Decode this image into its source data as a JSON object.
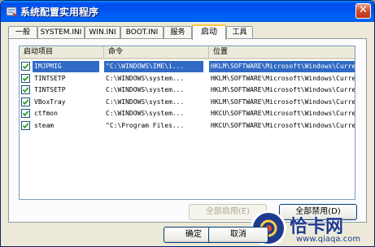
{
  "window": {
    "title": "系统配置实用程序",
    "close_glyph": "✕"
  },
  "tabs": [
    {
      "label": "一般"
    },
    {
      "label": "SYSTEM.INI"
    },
    {
      "label": "WIN.INI"
    },
    {
      "label": "BOOT.INI"
    },
    {
      "label": "服务"
    },
    {
      "label": "启动"
    },
    {
      "label": "工具"
    }
  ],
  "active_tab": "启动",
  "columns": [
    "启动项目",
    "命令",
    "位置"
  ],
  "rows": [
    {
      "checked": true,
      "selected": true,
      "name": "IMJPMIG",
      "command": "\"C:\\WINDOWS\\IME\\i...",
      "location": "HKLM\\SOFTWARE\\Microsoft\\Windows\\Current..."
    },
    {
      "checked": true,
      "selected": false,
      "name": "TINTSETP",
      "command": "C:\\WINDOWS\\system...",
      "location": "HKLM\\SOFTWARE\\Microsoft\\Windows\\Current..."
    },
    {
      "checked": true,
      "selected": false,
      "name": "TINTSETP",
      "command": "C:\\WINDOWS\\system...",
      "location": "HKLM\\SOFTWARE\\Microsoft\\Windows\\Current..."
    },
    {
      "checked": true,
      "selected": false,
      "name": "VBoxTray",
      "command": "C:\\WINDOWS\\system...",
      "location": "HKLM\\SOFTWARE\\Microsoft\\Windows\\Current..."
    },
    {
      "checked": true,
      "selected": false,
      "name": "ctfmon",
      "command": "C:\\WINDOWS\\system...",
      "location": "HKCU\\SOFTWARE\\Microsoft\\Windows\\Current..."
    },
    {
      "checked": true,
      "selected": false,
      "name": "steam",
      "command": "\"C:\\Program Files...",
      "location": "HKCU\\SOFTWARE\\Microsoft\\Windows\\Current..."
    }
  ],
  "buttons": {
    "enable_all": "全部启用(E)",
    "disable_all": "全部禁用(D)",
    "ok": "确定",
    "cancel": "取消"
  },
  "watermark": {
    "text": "恰卡网",
    "url": "www.qiaqa.com"
  },
  "colors": {
    "titlebar": "#0054e3",
    "selection": "#316ac5",
    "dialog_bg": "#ece9d8",
    "watermark": "#1f3b8f"
  }
}
